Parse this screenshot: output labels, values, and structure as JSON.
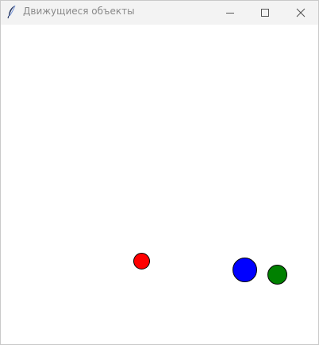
{
  "window": {
    "title": "Движущиеся объекты"
  },
  "title_controls": {
    "minimize_icon": "minimize-icon",
    "maximize_icon": "maximize-icon",
    "close_icon": "close-icon"
  },
  "canvas": {
    "background": "#ffffff",
    "objects": [
      {
        "name": "red-ball",
        "color": "#ff0000"
      },
      {
        "name": "blue-ball",
        "color": "#0000ff"
      },
      {
        "name": "green-ball",
        "color": "#008000"
      }
    ]
  }
}
